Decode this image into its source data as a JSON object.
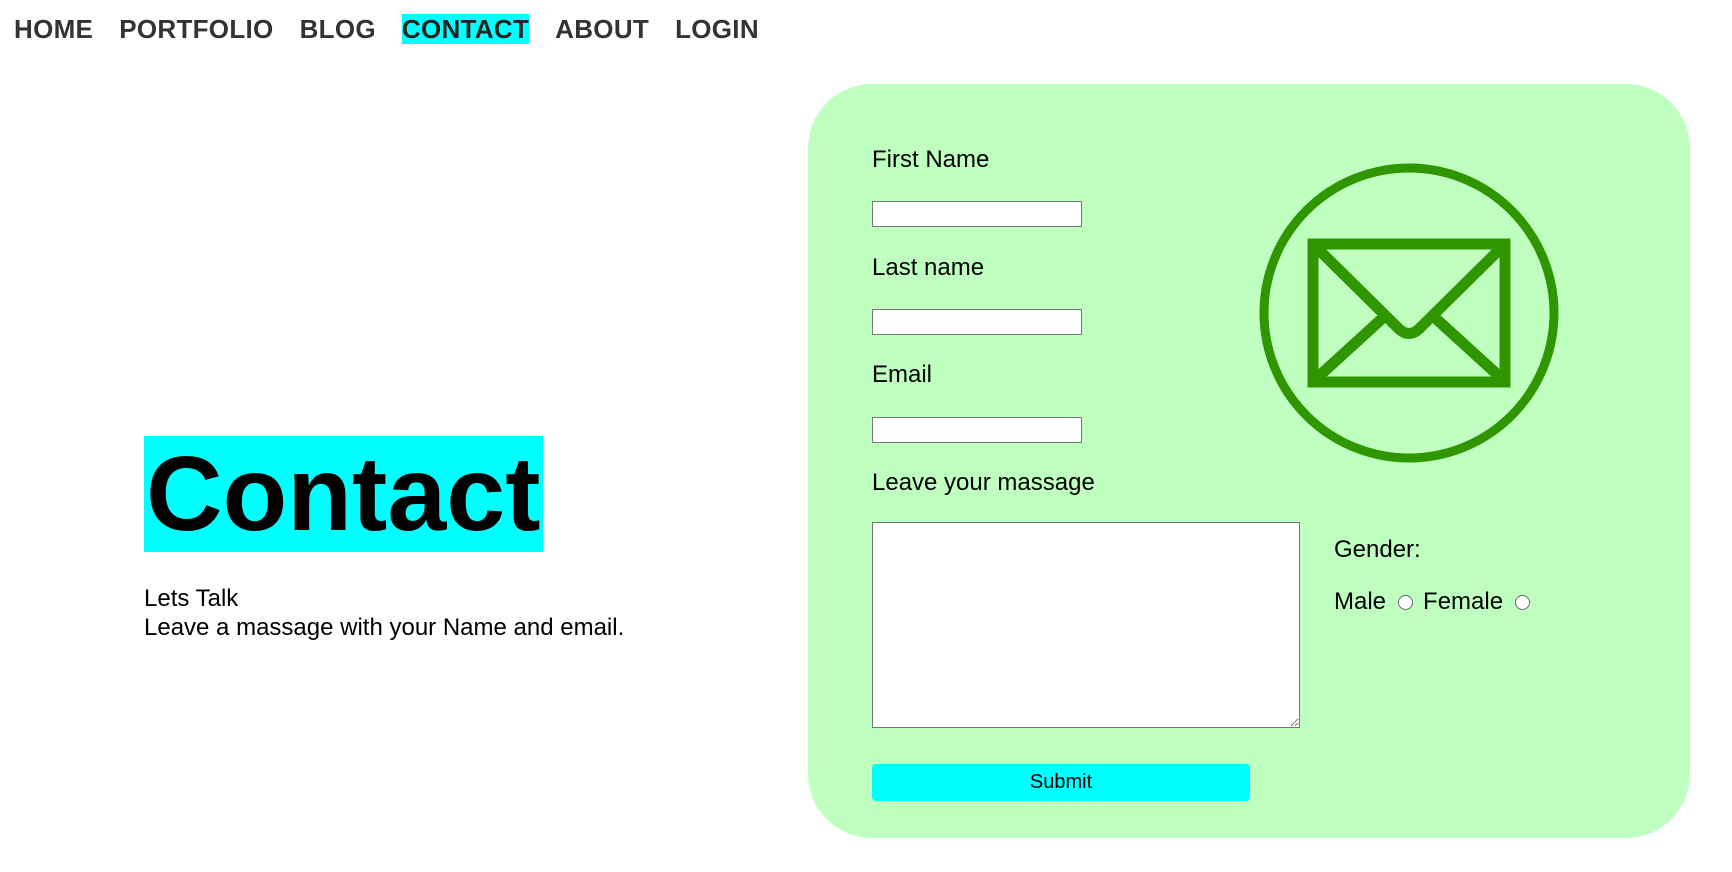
{
  "nav": {
    "items": [
      "HOME",
      "PORTFOLIO",
      "BLOG",
      "CONTACT",
      "ABOUT",
      "LOGIN"
    ],
    "active": "CONTACT"
  },
  "hero": {
    "title": "Contact",
    "line1": "Lets Talk",
    "line2": "Leave a massage with your Name and email."
  },
  "form": {
    "first_name_label": "First Name",
    "first_name_value": "",
    "last_name_label": "Last name",
    "last_name_value": "",
    "email_label": "Email",
    "email_value": "",
    "message_label": "Leave your massage",
    "message_value": "",
    "gender_label": "Gender:",
    "male_label": "Male",
    "female_label": "Female",
    "submit_label": "Submit"
  },
  "icons": {
    "mail": "mail-circle-icon"
  },
  "colors": {
    "accent": "#00ffff",
    "card_bg": "#bfffbf",
    "icon_green": "#2f9600",
    "nav_text": "#333333"
  }
}
